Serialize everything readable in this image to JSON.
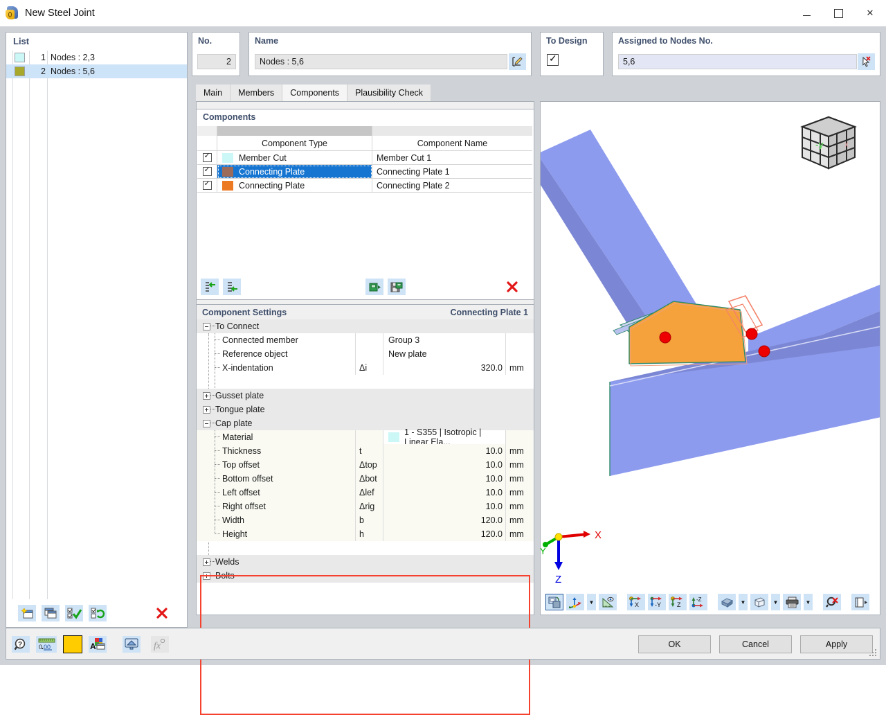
{
  "window": {
    "title": "New Steel Joint",
    "app_icon": "steel-joint-icon",
    "minimize": "–",
    "maximize": "□",
    "close": "✕"
  },
  "list_panel": {
    "header": "List",
    "items": [
      {
        "no": "1",
        "label": "Nodes : 2,3",
        "color": "#ccf7f7",
        "selected": false
      },
      {
        "no": "2",
        "label": "Nodes : 5,6",
        "color": "#a8a82c",
        "selected": true
      }
    ],
    "toolbar": [
      {
        "name": "new-joint-button",
        "icon": "new-window-icon"
      },
      {
        "name": "copy-joint-button",
        "icon": "copy-window-icon"
      },
      {
        "name": "select-all-button",
        "icon": "check-all-icon"
      },
      {
        "name": "invert-selection-button",
        "icon": "invert-check-icon"
      },
      {
        "name": "delete-joint-button",
        "icon": "red-x-icon"
      }
    ]
  },
  "no_box": {
    "label": "No.",
    "value": "2"
  },
  "name_box": {
    "label": "Name",
    "value": "Nodes : 5,6",
    "edit_button": "edit-name-icon"
  },
  "design_box": {
    "label": "To Design",
    "checked": true
  },
  "nodes_box": {
    "label": "Assigned to Nodes No.",
    "value": "5,6",
    "pick_button": "pick-nodes-icon"
  },
  "tabs": [
    {
      "label": "Main",
      "active": false
    },
    {
      "label": "Members",
      "active": false
    },
    {
      "label": "Components",
      "active": true
    },
    {
      "label": "Plausibility Check",
      "active": false
    }
  ],
  "components_panel": {
    "title": "Components",
    "columns": [
      "Component Type",
      "Component Name"
    ],
    "rows": [
      {
        "checked": true,
        "color": "#ccf7f7",
        "type": "Member Cut",
        "name": "Member Cut 1",
        "selected": false
      },
      {
        "checked": true,
        "color": "#9c6b5a",
        "type": "Connecting Plate",
        "name": "Connecting Plate 1",
        "selected": true
      },
      {
        "checked": true,
        "color": "#ec7a22",
        "type": "Connecting Plate",
        "name": "Connecting Plate 2",
        "selected": false
      }
    ],
    "toolbar": [
      {
        "name": "indent-left-button",
        "icon": "outdent-icon"
      },
      {
        "name": "indent-right-button",
        "icon": "indent-icon"
      },
      {
        "name": "import-component-button",
        "icon": "import-icon"
      },
      {
        "name": "save-component-button",
        "icon": "save-icon"
      },
      {
        "name": "delete-component-button",
        "icon": "red-x-icon"
      }
    ]
  },
  "component_settings": {
    "title": "Component Settings",
    "subject": "Connecting Plate 1",
    "groups": [
      {
        "name": "To Connect",
        "expanded": true,
        "rows": [
          {
            "label": "Connected member",
            "symbol": "",
            "value": "Group 3",
            "unit": "",
            "align": "left"
          },
          {
            "label": "Reference object",
            "symbol": "",
            "value": "New plate",
            "unit": "",
            "align": "left"
          },
          {
            "label": "X-indentation",
            "symbol": "Δi",
            "value": "320.0",
            "unit": "mm",
            "align": "right"
          }
        ]
      },
      {
        "name": "Gusset plate",
        "expanded": false,
        "rows": []
      },
      {
        "name": "Tongue plate",
        "expanded": false,
        "rows": []
      },
      {
        "name": "Cap plate",
        "expanded": true,
        "highlighted": true,
        "rows": [
          {
            "label": "Material",
            "symbol": "",
            "value": "1 - S355 | Isotropic | Linear Ela...",
            "unit": "",
            "align": "left",
            "swatch": "#ccf7f7"
          },
          {
            "label": "Thickness",
            "symbol": "t",
            "value": "10.0",
            "unit": "mm",
            "align": "right"
          },
          {
            "label": "Top offset",
            "symbol": "Δtop",
            "value": "10.0",
            "unit": "mm",
            "align": "right"
          },
          {
            "label": "Bottom offset",
            "symbol": "Δbot",
            "value": "10.0",
            "unit": "mm",
            "align": "right"
          },
          {
            "label": "Left offset",
            "symbol": "Δlef",
            "value": "10.0",
            "unit": "mm",
            "align": "right"
          },
          {
            "label": "Right offset",
            "symbol": "Δrig",
            "value": "10.0",
            "unit": "mm",
            "align": "right"
          },
          {
            "label": "Width",
            "symbol": "b",
            "value": "120.0",
            "unit": "mm",
            "align": "right"
          },
          {
            "label": "Height",
            "symbol": "h",
            "value": "120.0",
            "unit": "mm",
            "align": "right"
          }
        ]
      },
      {
        "name": "Welds",
        "expanded": false,
        "rows": []
      },
      {
        "name": "Bolts",
        "expanded": false,
        "rows": []
      }
    ],
    "highlight_color": "#f4422e"
  },
  "view3d": {
    "axes": {
      "x": "X",
      "y": "Y",
      "z": "Z",
      "x_color": "#e00000",
      "y_color": "#00b000",
      "z_color": "#0000e0"
    },
    "nav_cube_face": "-y",
    "colors": {
      "member": "#8d9bee",
      "member_shade": "#7b87d4",
      "plate": "#f5a23c",
      "bolt": "#ee0000",
      "outline": "#2f8a6a"
    },
    "toolbar": [
      {
        "name": "render-mode-button",
        "icon": "render-toggle-icon"
      },
      {
        "name": "axis-display-button",
        "icon": "axis-icon"
      },
      {
        "name": "axis-display-dropdown",
        "icon": "chevron-down-icon"
      },
      {
        "name": "measure-button",
        "icon": "ruler-eye-icon"
      },
      {
        "name": "view-x-button",
        "icon": "view-x-icon"
      },
      {
        "name": "view-negy-button",
        "icon": "view-negy-icon"
      },
      {
        "name": "view-z-button",
        "icon": "view-z-icon"
      },
      {
        "name": "view-negz-button",
        "icon": "view-negz-icon"
      },
      {
        "name": "shading-button",
        "icon": "solid-shade-icon"
      },
      {
        "name": "shading-dropdown",
        "icon": "chevron-down-icon"
      },
      {
        "name": "wireframe-button",
        "icon": "wireframe-cube-icon"
      },
      {
        "name": "wireframe-dropdown",
        "icon": "chevron-down-icon"
      },
      {
        "name": "print-button",
        "icon": "printer-icon"
      },
      {
        "name": "print-dropdown",
        "icon": "chevron-down-icon"
      },
      {
        "name": "zoom-reset-button",
        "icon": "zoom-cancel-icon"
      },
      {
        "name": "panel-toggle-button",
        "icon": "panel-expand-icon"
      }
    ]
  },
  "bottom_bar": {
    "left_tools": [
      {
        "name": "help-button",
        "icon": "question-magnifier-icon"
      },
      {
        "name": "units-button",
        "icon": "units-0-00-icon"
      },
      {
        "name": "color-button",
        "icon": "yellow-color-swatch-icon",
        "color": "#ffcc00"
      },
      {
        "name": "display-properties-button",
        "icon": "color-letter-icon"
      },
      {
        "name": "view-settings-button",
        "icon": "screen-icon"
      },
      {
        "name": "formula-button",
        "icon": "fx-icon",
        "disabled": true
      }
    ],
    "buttons": [
      {
        "label": "OK",
        "name": "ok-button"
      },
      {
        "label": "Cancel",
        "name": "cancel-button"
      },
      {
        "label": "Apply",
        "name": "apply-button"
      }
    ]
  }
}
